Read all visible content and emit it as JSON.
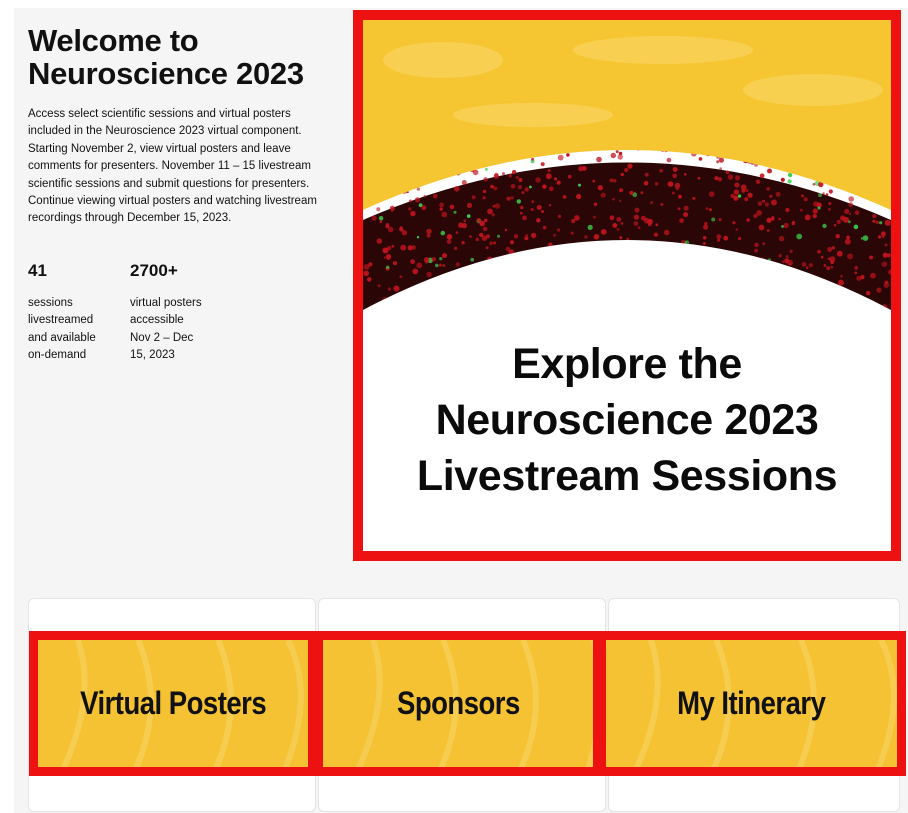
{
  "intro": {
    "title_line1": "Welcome to",
    "title_line2": "Neuroscience 2023",
    "lead": "Access select scientific sessions and virtual posters included in the Neuroscience 2023 virtual component. Starting November 2, view virtual posters and leave comments for presenters. November 11 – 15 livestream scientific sessions and submit questions for presenters. Continue viewing virtual posters and watching livestream recordings through December 15, 2023."
  },
  "stats": [
    {
      "value": "41",
      "desc_lines": [
        "sessions",
        "livestreamed",
        "and available",
        "on-demand"
      ]
    },
    {
      "value": "2700+",
      "desc_lines": [
        "virtual posters",
        "accessible",
        "Nov 2 – Dec",
        "15, 2023"
      ]
    }
  ],
  "hero": {
    "line1": "Explore the",
    "line2": "Neuroscience 2023",
    "line3": "Livestream Sessions"
  },
  "tiles": [
    {
      "label": "Virtual Posters"
    },
    {
      "label": "Sponsors"
    },
    {
      "label": "My Itinerary"
    }
  ],
  "colors": {
    "highlight_border": "#ee1111",
    "gold": "#f5c632",
    "tissue_red": "#c0141e",
    "tissue_green": "#3fcf4a"
  }
}
